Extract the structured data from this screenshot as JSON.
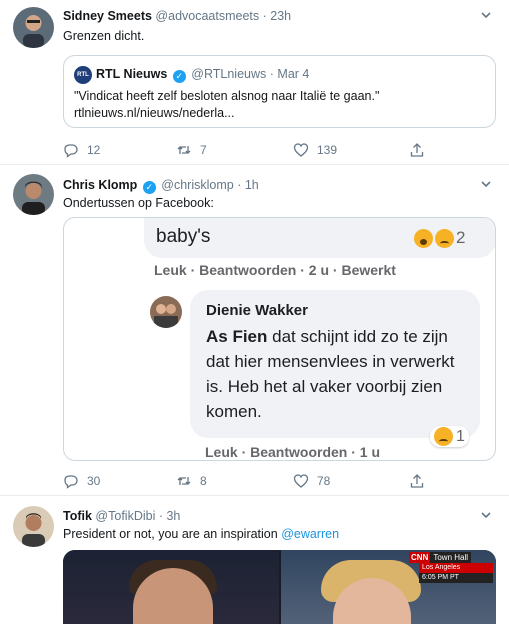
{
  "tweets": [
    {
      "name": "Sidney Smeets",
      "handle": "@advocaatsmeets",
      "time": "· 23h",
      "text": "Grenzen dicht.",
      "quote": {
        "logo": "RTL",
        "name": "RTL Nieuws",
        "handle": "@RTLnieuws",
        "time": "· Mar 4",
        "text": "\"Vindicat heeft zelf besloten alsnog naar Italië te gaan.\" rtlnieuws.nl/nieuws/nederla..."
      },
      "replies": "12",
      "retweets": "7",
      "likes": "139"
    },
    {
      "name": "Chris Klomp",
      "handle": "@chrisklomp",
      "time": "· 1h",
      "text": "Ondertussen op Facebook:",
      "facebook": {
        "top_comment_text": "baby's",
        "top_reaction_count": "2",
        "top_links": "Leuk · Beantwoorden · 2 u · Bewerkt",
        "commenter": "Dienie Wakker",
        "mention": "As Fien",
        "comment_text": " dat schijnt idd zo te zijn dat hier mensenvlees in verwerkt is. Heb het al vaker voorbij zien komen.",
        "reaction_count": "1",
        "links": "Leuk · Beantwoorden · 1 u"
      },
      "replies": "30",
      "retweets": "8",
      "likes": "78"
    },
    {
      "name": "Tofik",
      "handle": "@TofikDibi",
      "time": "· 3h",
      "text": "President or not, you are an inspiration ",
      "mention": "@ewarren",
      "media": {
        "network": "CNN",
        "show": "Town Hall",
        "location": "Los Angeles",
        "clock": "6:05 PM PT"
      }
    }
  ],
  "colors": {
    "link": "#1b95e0",
    "meta": "#657786",
    "border": "#e6ecf0",
    "verified": "#1da1f2"
  },
  "icons": [
    "reply-icon",
    "retweet-icon",
    "like-icon",
    "share-icon",
    "chevron-down-icon",
    "verified-icon"
  ]
}
